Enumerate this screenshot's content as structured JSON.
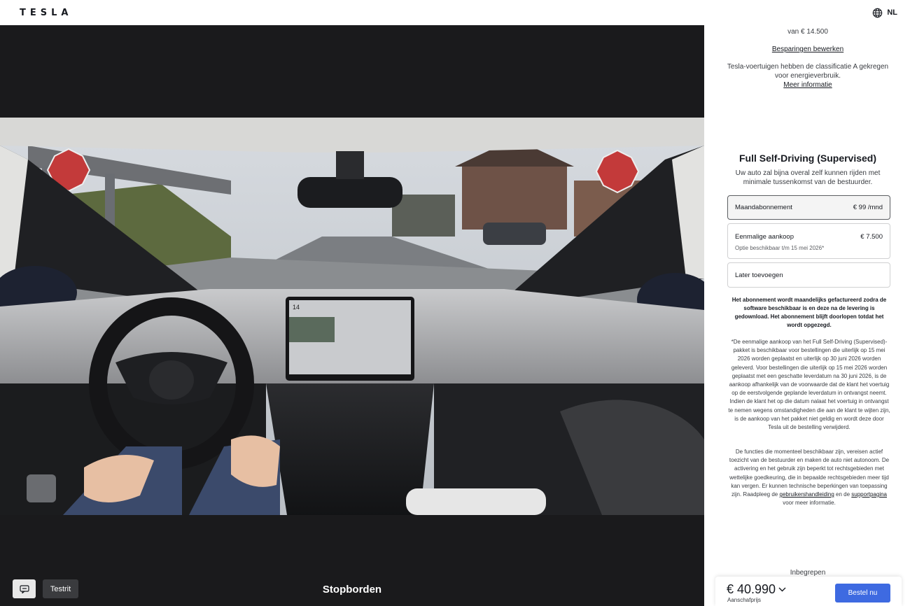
{
  "header": {
    "logo": "TESLA",
    "language": "NL"
  },
  "media": {
    "caption": "Stopborden",
    "testdrive_label": "Testrit",
    "screen_speed": "14"
  },
  "panel": {
    "savings_amount": "van € 14.500",
    "edit_savings": "Besparingen bewerken",
    "energy_text": "Tesla-voertuigen hebben de classificatie A gekregen voor energieverbruik.",
    "more_info": "Meer informatie",
    "fsd_title": "Full Self-Driving (Supervised)",
    "fsd_desc": "Uw auto zal bijna overal zelf kunnen rijden met minimale tussenkomst van de bestuurder.",
    "options": [
      {
        "label": "Maandabonnement",
        "price": "€ 99 /mnd"
      },
      {
        "label": "Eenmalige aankoop",
        "price": "€ 7.500",
        "sub": "Optie beschikbaar t/m 15 mei 2026*"
      },
      {
        "label": "Later toevoegen"
      }
    ],
    "notice": "Het abonnement wordt maandelijks gefactureerd zodra de software beschikbaar is en deze na de levering is gedownload. Het abonnement blijft doorlopen totdat het wordt opgezegd.",
    "disclaimer": "*De eenmalige aankoop van het Full Self-Driving (Supervised)-pakket is beschikbaar voor bestellingen die uiterlijk op 15 mei 2026 worden geplaatst en uiterlijk op 30 juni 2026 worden geleverd. Voor bestellingen die uiterlijk op 15 mei 2026 worden geplaatst met een geschatte leverdatum na 30 juni 2026, is de aankoop afhankelijk van de voorwaarde dat de klant het voertuig op de eerstvolgende geplande leverdatum in ontvangst neemt. Indien de klant het op die datum nalaat het voertuig in ontvangst te nemen wegens omstandigheden die aan de klant te wijten zijn, is de aankoop van het pakket niet geldig en wordt deze door Tesla uit de bestelling verwijderd.",
    "functions_text": "De functies die momenteel beschikbaar zijn, vereisen actief toezicht van de bestuurder en maken de auto niet autonoom. De activering en het gebruik zijn beperkt tot rechtsgebieden met wettelijke goedkeuring, die in bepaalde rechtsgebieden meer tijd kan vergen. Er kunnen technische beperkingen van toepassing zijn. Raadpleeg de",
    "manual_link": "gebruikershandleiding",
    "and_the": "en de",
    "support_link": "supportpagina",
    "for_more": "voor meer informatie.",
    "included": "Inbegrepen"
  },
  "pricebar": {
    "price": "€ 40.990",
    "label": "Aanschafprijs",
    "order": "Bestel nu"
  },
  "colors": {
    "accent": "#3e6ae1",
    "media_bg": "#1a1a1c",
    "text": "#171a20"
  }
}
